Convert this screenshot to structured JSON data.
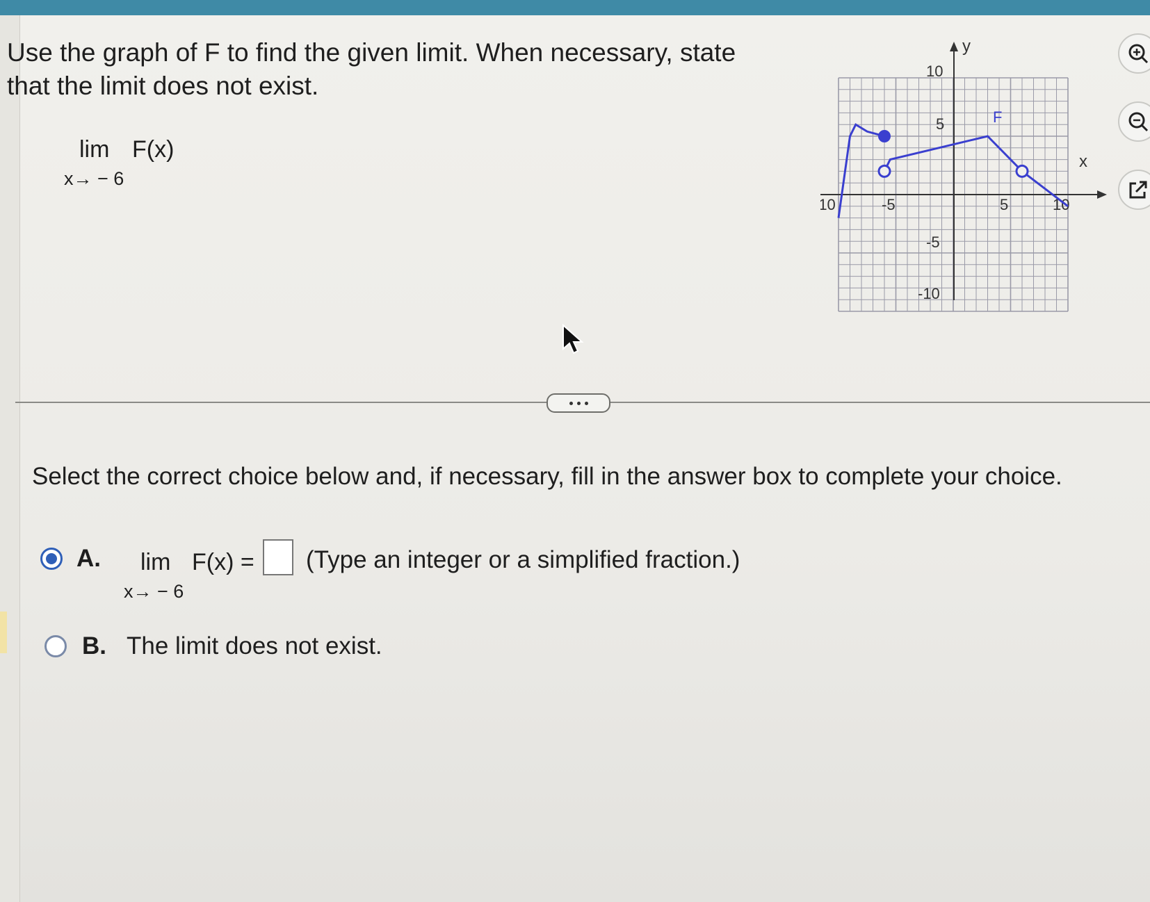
{
  "question": {
    "text_line1": "Use the graph of F to find the given limit. When necessary, state",
    "text_line2": "that the limit does not exist.",
    "limit": {
      "word": "lim",
      "function": "F(x)",
      "approach": "x→ − 6"
    }
  },
  "graph": {
    "y_axis_label": "y",
    "x_axis_label": "x",
    "function_label": "F",
    "tick_labels": {
      "x_neg10": "-10",
      "x_neg5": "-5",
      "x_5": "5",
      "x_10": "10",
      "y_10": "10",
      "y_5": "5",
      "y_neg5": "-5",
      "y_neg10": "-10"
    },
    "curve_color": "#3a3fcf",
    "grid_color": "#9a9aa8",
    "curve_points": [
      [
        -10,
        -2
      ],
      [
        -9,
        5
      ],
      [
        -8.5,
        6
      ],
      [
        -7.5,
        5.4
      ],
      [
        -6,
        5
      ]
    ],
    "curve2_points": [
      [
        -6,
        2
      ],
      [
        -5.5,
        3
      ],
      [
        3,
        5
      ],
      [
        6,
        2
      ],
      [
        10,
        -1
      ]
    ],
    "filled_points": [
      [
        -6,
        5
      ]
    ],
    "open_points": [
      [
        -6,
        2
      ],
      [
        6,
        2
      ]
    ]
  },
  "toolbar": {
    "zoom_in_icon": "zoom-in-icon",
    "zoom_out_icon": "zoom-out-icon",
    "popout_icon": "external-link-icon"
  },
  "more_button": {
    "icon": "ellipsis-icon"
  },
  "instruction": "Select the correct choice below and, if necessary, fill in the answer box to complete your choice.",
  "choices": {
    "a": {
      "letter": "A.",
      "lim_word": "lim",
      "function": "F(x) =",
      "approach": "x→ − 6",
      "hint": "(Type an integer or a simplified fraction.)",
      "selected": true,
      "answer_value": ""
    },
    "b": {
      "letter": "B.",
      "text": "The limit does not exist.",
      "selected": false
    }
  }
}
